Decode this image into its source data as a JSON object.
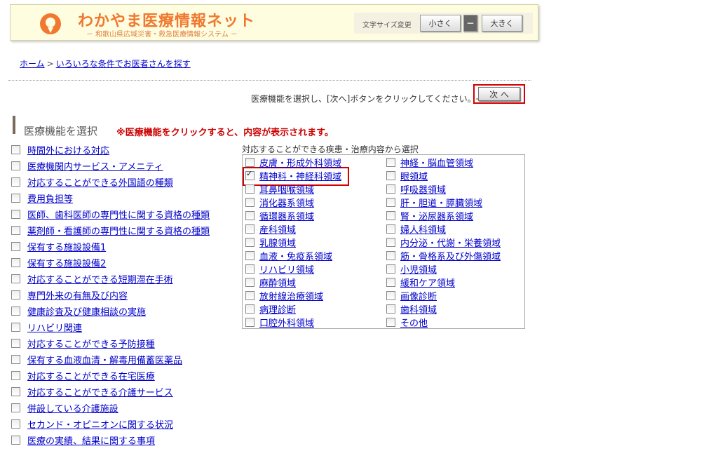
{
  "header": {
    "title": "わかやま医療情報ネット",
    "subtitle": "－ 和歌山県広域災害・救急医療情報システム －",
    "font_size_label": "文字サイズ変更",
    "font_small": "小さく",
    "font_mid": "－",
    "font_large": "大きく",
    "accent_color": "#f07830"
  },
  "breadcrumb": {
    "home": "ホーム",
    "separator": ">",
    "current": "いろいろな条件でお医者さんを探す"
  },
  "instruction": "医療機能を選択し、[次へ]ボタンをクリックしてください。→",
  "next_button": "次 へ",
  "section": {
    "title": "医療機能を選択",
    "note": "※医療機能をクリックすると、内容が表示されます。"
  },
  "functions": [
    "時間外における対応",
    "医療機関内サービス・アメニティ",
    "対応することができる外国語の種類",
    "費用負担等",
    "医師、歯科医師の専門性に関する資格の種類",
    "薬剤師・看護師の専門性に関する資格の種類",
    "保有する施設設備1",
    "保有する施設設備2",
    "対応することができる短期滞在手術",
    "専門外来の有無及び内容",
    "健康診査及び健康相談の実施",
    "リハビリ関連",
    "対応することができる予防接種",
    "保有する血液血清・解毒用備蓄医薬品",
    "対応することができる在宅医療",
    "対応することができる介護サービス",
    "併設している介護施設",
    "セカンド・オピニオンに関する状況",
    "医療の実績、結果に関する事項"
  ],
  "disease_caption": "対応することができる疾患・治療内容から選択",
  "diseases_left": [
    {
      "label": "皮膚・形成外科領域",
      "checked": false
    },
    {
      "label": "精神科・神経科領域",
      "checked": true
    },
    {
      "label": "耳鼻咽喉領域",
      "checked": false
    },
    {
      "label": "消化器系領域",
      "checked": false
    },
    {
      "label": "循環器系領域",
      "checked": false
    },
    {
      "label": "産科領域",
      "checked": false
    },
    {
      "label": "乳腺領域",
      "checked": false
    },
    {
      "label": "血液・免疫系領域",
      "checked": false
    },
    {
      "label": "リハビリ領域",
      "checked": false
    },
    {
      "label": "麻酔領域",
      "checked": false
    },
    {
      "label": "放射線治療領域",
      "checked": false
    },
    {
      "label": "病理診断",
      "checked": false
    },
    {
      "label": "口腔外科領域",
      "checked": false
    }
  ],
  "diseases_right": [
    {
      "label": "神経・脳血管領域",
      "checked": false
    },
    {
      "label": "眼領域",
      "checked": false
    },
    {
      "label": "呼吸器領域",
      "checked": false
    },
    {
      "label": "肝・胆道・膵臓領域",
      "checked": false
    },
    {
      "label": "腎・泌尿器系領域",
      "checked": false
    },
    {
      "label": "婦人科領域",
      "checked": false
    },
    {
      "label": "内分泌・代謝・栄養領域",
      "checked": false
    },
    {
      "label": "筋・骨格系及び外傷領域",
      "checked": false
    },
    {
      "label": "小児領域",
      "checked": false
    },
    {
      "label": "緩和ケア領域",
      "checked": false
    },
    {
      "label": "画像診断",
      "checked": false
    },
    {
      "label": "歯科領域",
      "checked": false
    },
    {
      "label": "その他",
      "checked": false
    }
  ]
}
